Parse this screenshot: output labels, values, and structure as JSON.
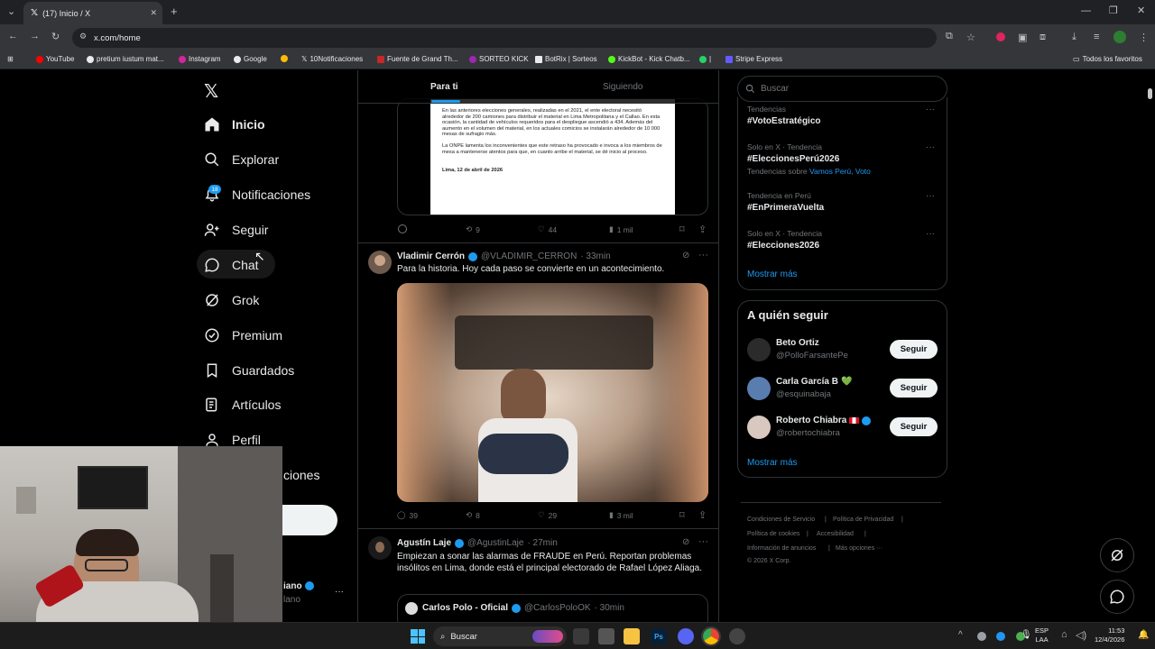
{
  "browser": {
    "tab_title": "(17) Inicio / X",
    "url": "x.com/home",
    "bookmarks": [
      "YouTube",
      "pretium iustum mat...",
      "Instagram",
      "Google",
      "",
      "10Notificaciones",
      "Fuente de Grand Th...",
      "SORTEO KICK",
      "BotRix | Sorteos",
      "KickBot - Kick Chatb...",
      "",
      "Stripe Express"
    ],
    "bookmarks_all": "Todos los favoritos"
  },
  "nav": {
    "items": [
      "Inicio",
      "Explorar",
      "Notificaciones",
      "Seguir",
      "Chat",
      "Grok",
      "Premium",
      "Guardados",
      "Artículos",
      "Perfil",
      "ciones"
    ],
    "badge": "18",
    "post_button_fragment": "r",
    "account_name_fragment": "iano",
    "account_handle_fragment": "lano",
    "more": "···"
  },
  "feed": {
    "tabs": [
      "Para ti",
      "Siguiendo"
    ],
    "doc_image": {
      "paragraph1": "En las anteriores elecciones generales, realizadas en el 2021, el ente electoral necesitó alrededor de 200 camiones para distribuir el material en Lima Metropolitana y el Callao. En esta ocasión, la cantidad de vehículos requeridos para el despliegue ascendió a 434. Además del aumento en el volumen del material, en los actuales comicios se instalarán alrededor de 10 000 mesas de sufragio más.",
      "paragraph2": "La ONPE lamenta los inconvenientes que este retraso ha provocado e invoca a los miembros de mesa a mantenerse atentos para que, en cuanto arribe el material, se dé inicio al proceso.",
      "signoff": "Lima, 12 de abril de 2026"
    },
    "post0_actions": {
      "reposts": "9",
      "likes": "44",
      "views": "1 mil"
    },
    "post1": {
      "name": "Vladimir Cerrón",
      "handle": "@VLADIMIR_CERRON",
      "time": "· 33min",
      "text": "Para la historia. Hoy cada paso se convierte en un acontecimiento.",
      "replies": "39",
      "reposts": "8",
      "likes": "29",
      "views": "3 mil"
    },
    "post2": {
      "name": "Agustín Laje",
      "handle": "@AgustinLaje",
      "time": "· 27min",
      "text": "Empiezan a sonar las alarmas de FRAUDE en Perú. Reportan problemas insólitos en Lima, donde está el principal electorado de Rafael López Aliaga.",
      "quote_name": "Carlos Polo - Oficial",
      "quote_handle": "@CarlosPoloOK",
      "quote_time": "· 30min"
    }
  },
  "sidebar": {
    "search_placeholder": "Buscar",
    "trends": [
      {
        "context": "Tendencias",
        "name": "#VotoEstratégico",
        "extra": ""
      },
      {
        "context": "Solo en X · Tendencia",
        "name": "#EleccionesPerú2026",
        "extra": "Tendencias sobre ",
        "extra_links": "Vamos Perú, Voto"
      },
      {
        "context": "Tendencia en Perú",
        "name": "#EnPrimeraVuelta",
        "extra": ""
      },
      {
        "context": "Solo en X · Tendencia",
        "name": "#Elecciones2026",
        "extra": ""
      }
    ],
    "show_more": "Mostrar más",
    "who_to_follow_title": "A quién seguir",
    "suggestions": [
      {
        "name": "Beto Ortiz",
        "handle": "@PolloFarsantePe",
        "button": "Seguir"
      },
      {
        "name": "Carla García B",
        "handle": "@esquinabaja",
        "button": "Seguir",
        "emoji": "💚"
      },
      {
        "name": "Roberto Chiabra",
        "handle": "@robertochiabra",
        "button": "Seguir"
      }
    ],
    "show_more2": "Mostrar más",
    "footer": [
      "Condiciones de Servicio",
      "|",
      "Política de Privacidad",
      "|",
      "Política de cookies",
      "|",
      "Accesibilidad",
      "|",
      "Información de anuncios",
      "|",
      "Más opciones ···",
      "© 2026 X Corp."
    ]
  },
  "taskbar": {
    "search": "Buscar",
    "lang_top": "ESP",
    "lang_bottom": "LAA",
    "time": "11:53",
    "date": "12/4/2026"
  },
  "colors": {
    "accent": "#1d9bf0",
    "bg": "#000000",
    "border": "#2f3336",
    "muted": "#71767b"
  }
}
